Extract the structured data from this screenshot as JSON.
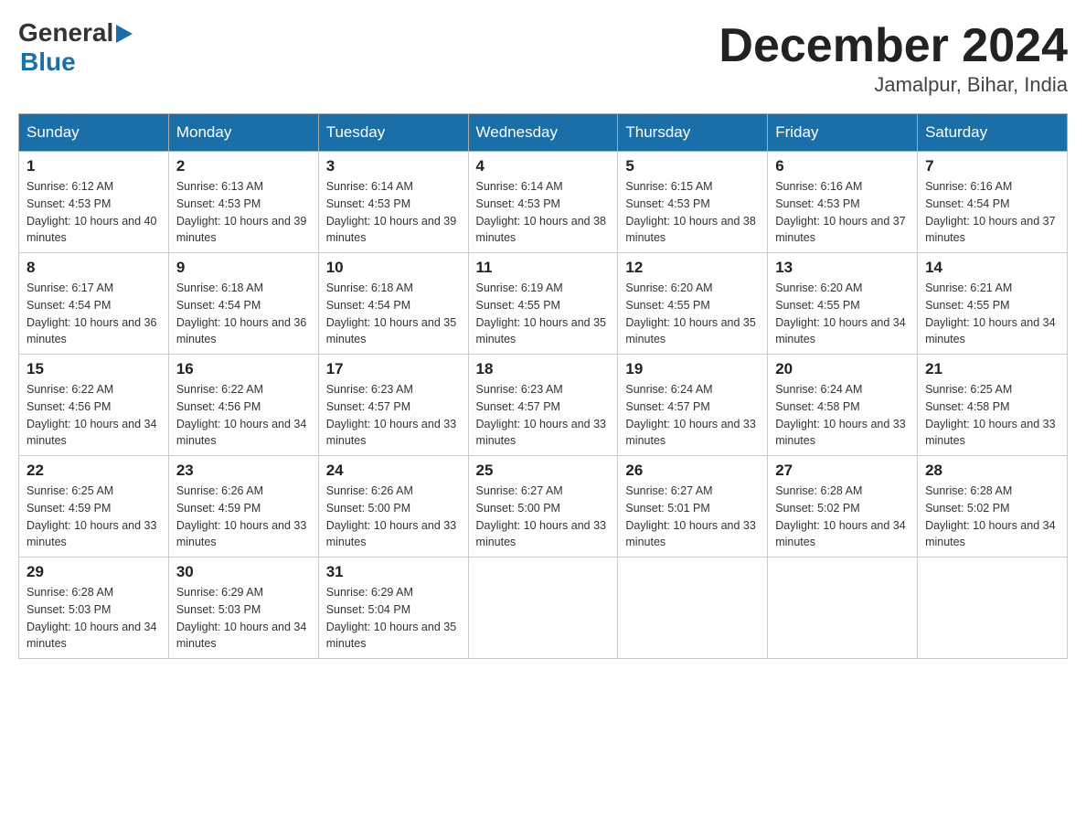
{
  "logo": {
    "general": "General",
    "blue": "Blue",
    "arrow": "▶"
  },
  "title": "December 2024",
  "subtitle": "Jamalpur, Bihar, India",
  "days": [
    "Sunday",
    "Monday",
    "Tuesday",
    "Wednesday",
    "Thursday",
    "Friday",
    "Saturday"
  ],
  "weeks": [
    [
      {
        "day": "1",
        "sunrise": "6:12 AM",
        "sunset": "4:53 PM",
        "daylight": "10 hours and 40 minutes."
      },
      {
        "day": "2",
        "sunrise": "6:13 AM",
        "sunset": "4:53 PM",
        "daylight": "10 hours and 39 minutes."
      },
      {
        "day": "3",
        "sunrise": "6:14 AM",
        "sunset": "4:53 PM",
        "daylight": "10 hours and 39 minutes."
      },
      {
        "day": "4",
        "sunrise": "6:14 AM",
        "sunset": "4:53 PM",
        "daylight": "10 hours and 38 minutes."
      },
      {
        "day": "5",
        "sunrise": "6:15 AM",
        "sunset": "4:53 PM",
        "daylight": "10 hours and 38 minutes."
      },
      {
        "day": "6",
        "sunrise": "6:16 AM",
        "sunset": "4:53 PM",
        "daylight": "10 hours and 37 minutes."
      },
      {
        "day": "7",
        "sunrise": "6:16 AM",
        "sunset": "4:54 PM",
        "daylight": "10 hours and 37 minutes."
      }
    ],
    [
      {
        "day": "8",
        "sunrise": "6:17 AM",
        "sunset": "4:54 PM",
        "daylight": "10 hours and 36 minutes."
      },
      {
        "day": "9",
        "sunrise": "6:18 AM",
        "sunset": "4:54 PM",
        "daylight": "10 hours and 36 minutes."
      },
      {
        "day": "10",
        "sunrise": "6:18 AM",
        "sunset": "4:54 PM",
        "daylight": "10 hours and 35 minutes."
      },
      {
        "day": "11",
        "sunrise": "6:19 AM",
        "sunset": "4:55 PM",
        "daylight": "10 hours and 35 minutes."
      },
      {
        "day": "12",
        "sunrise": "6:20 AM",
        "sunset": "4:55 PM",
        "daylight": "10 hours and 35 minutes."
      },
      {
        "day": "13",
        "sunrise": "6:20 AM",
        "sunset": "4:55 PM",
        "daylight": "10 hours and 34 minutes."
      },
      {
        "day": "14",
        "sunrise": "6:21 AM",
        "sunset": "4:55 PM",
        "daylight": "10 hours and 34 minutes."
      }
    ],
    [
      {
        "day": "15",
        "sunrise": "6:22 AM",
        "sunset": "4:56 PM",
        "daylight": "10 hours and 34 minutes."
      },
      {
        "day": "16",
        "sunrise": "6:22 AM",
        "sunset": "4:56 PM",
        "daylight": "10 hours and 34 minutes."
      },
      {
        "day": "17",
        "sunrise": "6:23 AM",
        "sunset": "4:57 PM",
        "daylight": "10 hours and 33 minutes."
      },
      {
        "day": "18",
        "sunrise": "6:23 AM",
        "sunset": "4:57 PM",
        "daylight": "10 hours and 33 minutes."
      },
      {
        "day": "19",
        "sunrise": "6:24 AM",
        "sunset": "4:57 PM",
        "daylight": "10 hours and 33 minutes."
      },
      {
        "day": "20",
        "sunrise": "6:24 AM",
        "sunset": "4:58 PM",
        "daylight": "10 hours and 33 minutes."
      },
      {
        "day": "21",
        "sunrise": "6:25 AM",
        "sunset": "4:58 PM",
        "daylight": "10 hours and 33 minutes."
      }
    ],
    [
      {
        "day": "22",
        "sunrise": "6:25 AM",
        "sunset": "4:59 PM",
        "daylight": "10 hours and 33 minutes."
      },
      {
        "day": "23",
        "sunrise": "6:26 AM",
        "sunset": "4:59 PM",
        "daylight": "10 hours and 33 minutes."
      },
      {
        "day": "24",
        "sunrise": "6:26 AM",
        "sunset": "5:00 PM",
        "daylight": "10 hours and 33 minutes."
      },
      {
        "day": "25",
        "sunrise": "6:27 AM",
        "sunset": "5:00 PM",
        "daylight": "10 hours and 33 minutes."
      },
      {
        "day": "26",
        "sunrise": "6:27 AM",
        "sunset": "5:01 PM",
        "daylight": "10 hours and 33 minutes."
      },
      {
        "day": "27",
        "sunrise": "6:28 AM",
        "sunset": "5:02 PM",
        "daylight": "10 hours and 34 minutes."
      },
      {
        "day": "28",
        "sunrise": "6:28 AM",
        "sunset": "5:02 PM",
        "daylight": "10 hours and 34 minutes."
      }
    ],
    [
      {
        "day": "29",
        "sunrise": "6:28 AM",
        "sunset": "5:03 PM",
        "daylight": "10 hours and 34 minutes."
      },
      {
        "day": "30",
        "sunrise": "6:29 AM",
        "sunset": "5:03 PM",
        "daylight": "10 hours and 34 minutes."
      },
      {
        "day": "31",
        "sunrise": "6:29 AM",
        "sunset": "5:04 PM",
        "daylight": "10 hours and 35 minutes."
      },
      null,
      null,
      null,
      null
    ]
  ]
}
